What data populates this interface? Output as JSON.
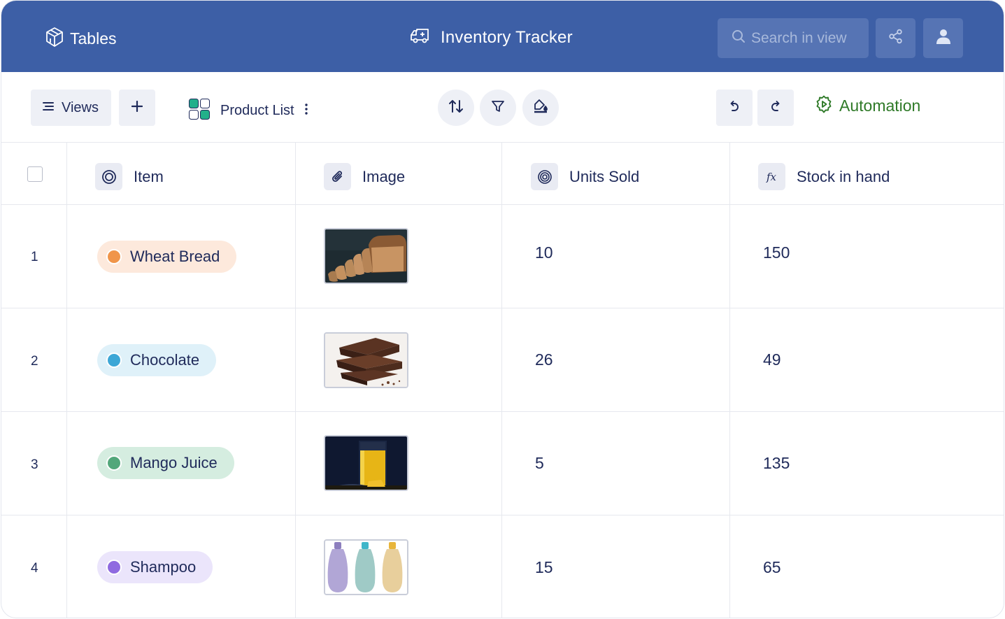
{
  "header": {
    "brand": "Tables",
    "title": "Inventory Tracker",
    "search_placeholder": "Search in view"
  },
  "toolbar": {
    "views_label": "Views",
    "view_name": "Product List",
    "automation_label": "Automation"
  },
  "columns": [
    {
      "label": "Item",
      "icon": "single-select-icon"
    },
    {
      "label": "Image",
      "icon": "attachment-icon"
    },
    {
      "label": "Units Sold",
      "icon": "number-icon"
    },
    {
      "label": "Stock in hand",
      "icon": "formula-icon"
    }
  ],
  "rows": [
    {
      "num": "1",
      "item": "Wheat Bread",
      "units_sold": "10",
      "stock": "150",
      "color": "#f0954a",
      "pill_bg": "#fde9dc",
      "image": "bread-photo"
    },
    {
      "num": "2",
      "item": "Chocolate",
      "units_sold": "26",
      "stock": "49",
      "color": "#3da7d6",
      "pill_bg": "#dff1f9",
      "image": "chocolate-photo"
    },
    {
      "num": "3",
      "item": "Mango Juice",
      "units_sold": "5",
      "stock": "135",
      "color": "#52a77a",
      "pill_bg": "#d5ede0",
      "image": "juice-photo"
    },
    {
      "num": "4",
      "item": "Shampoo",
      "units_sold": "15",
      "stock": "65",
      "color": "#8f6ae0",
      "pill_bg": "#ebe5fb",
      "image": "shampoo-photo"
    }
  ],
  "colors": {
    "header_bg": "#3d5fa6",
    "automation": "#2f7a28",
    "text": "#1f2a5a"
  }
}
